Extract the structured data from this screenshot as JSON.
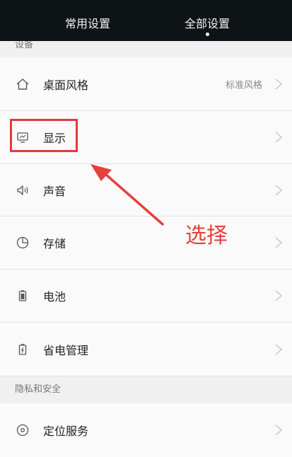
{
  "tabs": [
    {
      "label": "常用设置",
      "selected": false
    },
    {
      "label": "全部设置",
      "selected": true
    }
  ],
  "sections": {
    "device": {
      "title": "设备"
    },
    "privacy": {
      "title": "隐私和安全"
    }
  },
  "rows": {
    "desktop_style": {
      "label": "桌面风格",
      "value": "标准风格",
      "icon": "home-icon"
    },
    "display": {
      "label": "显示",
      "icon": "monitor-icon"
    },
    "sound": {
      "label": "声音",
      "icon": "speaker-icon"
    },
    "storage": {
      "label": "存储",
      "icon": "pie-chart-icon"
    },
    "battery": {
      "label": "电池",
      "icon": "battery-icon"
    },
    "power_saving": {
      "label": "省电管理",
      "icon": "battery-saver-icon"
    },
    "location": {
      "label": "定位服务",
      "icon": "location-pin-icon"
    }
  },
  "annotation": {
    "text": "选择",
    "color": "#e5413d"
  },
  "colors": {
    "tabbar": "#0e1316",
    "row_bg": "#fafafa",
    "annotation": "#e23b3b"
  }
}
